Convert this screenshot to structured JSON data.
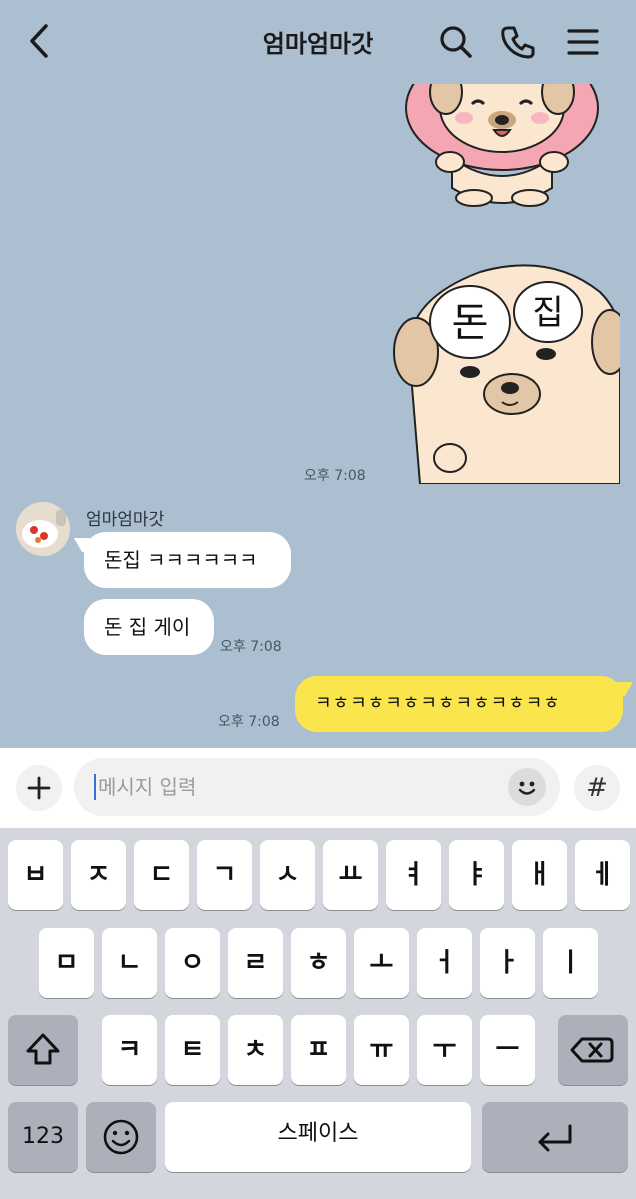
{
  "header": {
    "title": "엄마엄마갓"
  },
  "messages": {
    "time_1": "오후 7:08",
    "sender_name": "엄마엄마갓",
    "bubble_1": "돈집 ㅋㅋㅋㅋㅋㅋ",
    "bubble_2": "돈 집 게이",
    "time_2": "오후 7:08",
    "my_bubble": "ㅋㅎㅋㅎㅋㅎㅋㅎㅋㅎㅋㅎㅋㅎ",
    "time_3": "오후 7:08",
    "sticker_text_left": "돈",
    "sticker_text_right": "집"
  },
  "input": {
    "placeholder": "메시지 입력",
    "hash_label": "#",
    "plus_label": "+"
  },
  "keyboard": {
    "row1": [
      "ㅂ",
      "ㅈ",
      "ㄷ",
      "ㄱ",
      "ㅅ",
      "ㅛ",
      "ㅕ",
      "ㅑ",
      "ㅐ",
      "ㅔ"
    ],
    "row2": [
      "ㅁ",
      "ㄴ",
      "ㅇ",
      "ㄹ",
      "ㅎ",
      "ㅗ",
      "ㅓ",
      "ㅏ",
      "ㅣ"
    ],
    "row3": [
      "ㅋ",
      "ㅌ",
      "ㅊ",
      "ㅍ",
      "ㅠ",
      "ㅜ",
      "ㅡ"
    ],
    "numbers_label": "123",
    "space_label": "스페이스"
  },
  "colors": {
    "chat_bg": "#abbfd1",
    "my_bubble": "#fbe54d",
    "other_bubble": "#ffffff",
    "keyboard_bg": "#d3d6dd",
    "dark_key": "#abb0ba"
  }
}
